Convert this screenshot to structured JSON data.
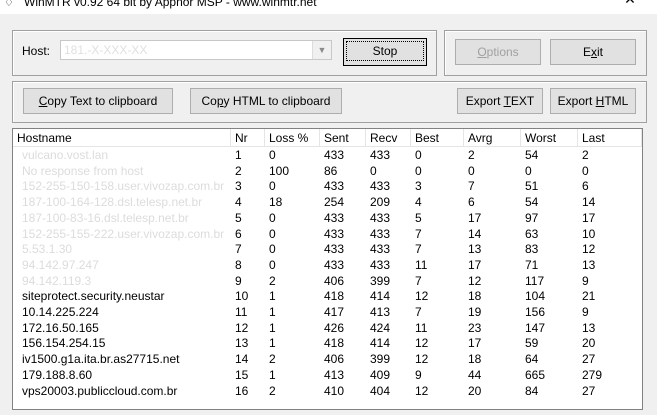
{
  "window": {
    "title": "WinMTR v0.92 64 bit by Appnor MSP - www.winmtr.net",
    "minimize": "—",
    "close": "✕"
  },
  "host": {
    "label": "Host:",
    "value": "181.-X-XXX-XX"
  },
  "buttons": {
    "stop": "Stop",
    "options_accel": "O",
    "options_rest": "ptions",
    "exit_pre": "E",
    "exit_accel": "x",
    "exit_post": "it",
    "copy_text_accel": "C",
    "copy_text_rest": "opy Text to clipboard",
    "copy_html_pre": "Co",
    "copy_html_accel": "p",
    "copy_html_post": "y HTML to clipboard",
    "export_text_pre": "Export ",
    "export_text_accel": "T",
    "export_text_post": "EXT",
    "export_html_pre": "Export ",
    "export_html_accel": "H",
    "export_html_post": "TML"
  },
  "table": {
    "headers": [
      "Hostname",
      "Nr",
      "Loss %",
      "Sent",
      "Recv",
      "Best",
      "Avrg",
      "Worst",
      "Last"
    ],
    "rows": [
      [
        "vulcano.vost.lan",
        "1",
        "0",
        "433",
        "433",
        "0",
        "2",
        "54",
        "2"
      ],
      [
        "No response from host",
        "2",
        "100",
        "86",
        "0",
        "0",
        "0",
        "0",
        "0"
      ],
      [
        "152-255-150-158.user.vivozap.com.br",
        "3",
        "0",
        "433",
        "433",
        "3",
        "7",
        "51",
        "6"
      ],
      [
        "187-100-164-128.dsl.telesp.net.br",
        "4",
        "18",
        "254",
        "209",
        "4",
        "6",
        "54",
        "14"
      ],
      [
        "187-100-83-16.dsl.telesp.net.br",
        "5",
        "0",
        "433",
        "433",
        "5",
        "17",
        "97",
        "17"
      ],
      [
        "152-255-155-222.user.vivozap.com.br",
        "6",
        "0",
        "433",
        "433",
        "7",
        "14",
        "63",
        "10"
      ],
      [
        "5.53.1.30",
        "7",
        "0",
        "433",
        "433",
        "7",
        "13",
        "83",
        "12"
      ],
      [
        "94.142.97.247",
        "8",
        "0",
        "433",
        "433",
        "11",
        "17",
        "71",
        "13"
      ],
      [
        "94.142.119.3",
        "9",
        "2",
        "406",
        "399",
        "7",
        "12",
        "117",
        "9"
      ],
      [
        "siteprotect.security.neustar",
        "10",
        "1",
        "418",
        "414",
        "12",
        "18",
        "104",
        "21"
      ],
      [
        "10.14.225.224",
        "11",
        "1",
        "417",
        "413",
        "7",
        "19",
        "156",
        "9"
      ],
      [
        "172.16.50.165",
        "12",
        "1",
        "426",
        "424",
        "11",
        "23",
        "147",
        "13"
      ],
      [
        "156.154.254.15",
        "13",
        "1",
        "418",
        "414",
        "12",
        "17",
        "59",
        "20"
      ],
      [
        "iv1500.g1a.ita.br.as27715.net",
        "14",
        "2",
        "406",
        "399",
        "12",
        "18",
        "64",
        "27"
      ],
      [
        "179.188.8.60",
        "15",
        "1",
        "413",
        "409",
        "9",
        "44",
        "665",
        "279"
      ],
      [
        "vps20003.publiccloud.com.br",
        "16",
        "2",
        "410",
        "404",
        "12",
        "20",
        "84",
        "27"
      ]
    ]
  }
}
